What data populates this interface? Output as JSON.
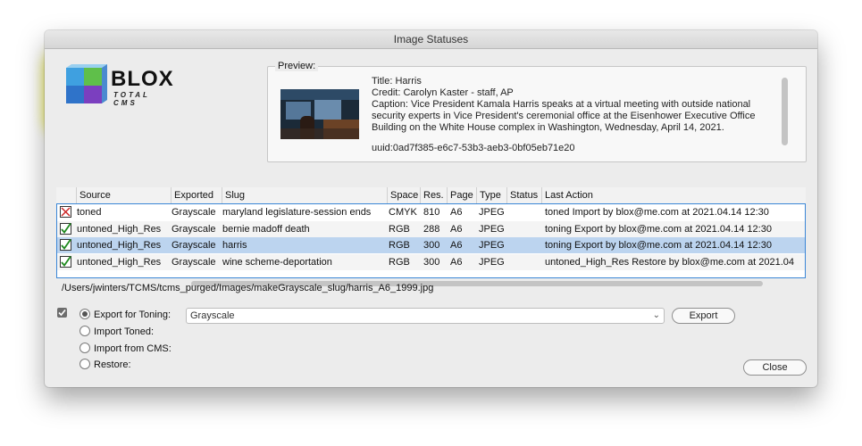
{
  "window": {
    "title": "Image Statuses"
  },
  "logo": {
    "name": "BLOX",
    "subtitle": "TOTAL CMS"
  },
  "preview": {
    "legend": "Preview:",
    "lines": [
      "Title: Harris",
      "Credit: Carolyn Kaster - staff, AP",
      "Caption: Vice President Kamala Harris speaks at a virtual meeting with outside national security experts in Vice President's ceremonial office at the Eisenhower Executive Office Building on the White House complex in Washington, Wednesday, April 14, 2021.",
      "uuid:0ad7f385-e6c7-53b3-aeb3-0bf05eb71e20"
    ]
  },
  "table": {
    "headers": [
      "Source",
      "Exported",
      "Slug",
      "Space",
      "Res.",
      "Page",
      "Type",
      "Status",
      "Last Action"
    ],
    "rows": [
      {
        "checkbox": "error",
        "source": "toned",
        "exported": "Grayscale",
        "slug": "maryland legislature-session ends",
        "space": "CMYK",
        "res": "810",
        "page": "A6",
        "type": "JPEG",
        "status": "",
        "last_action": "toned Import by blox@me.com at 2021.04.14 12:30"
      },
      {
        "checkbox": "ok",
        "source": "untoned_High_Res",
        "exported": "Grayscale",
        "slug": "bernie madoff death",
        "space": "RGB",
        "res": "288",
        "page": "A6",
        "type": "JPEG",
        "status": "",
        "last_action": "toning Export by blox@me.com at 2021.04.14 12:30"
      },
      {
        "checkbox": "ok",
        "source": "untoned_High_Res",
        "exported": "Grayscale",
        "slug": "harris",
        "space": "RGB",
        "res": "300",
        "page": "A6",
        "type": "JPEG",
        "status": "",
        "last_action": "toning Export by blox@me.com at 2021.04.14 12:30"
      },
      {
        "checkbox": "ok",
        "source": "untoned_High_Res",
        "exported": "Grayscale",
        "slug": "wine scheme-deportation",
        "space": "RGB",
        "res": "300",
        "page": "A6",
        "type": "JPEG",
        "status": "",
        "last_action": "untoned_High_Res Restore by blox@me.com at 2021.04"
      }
    ],
    "selected_row": 2
  },
  "file_path": "/Users/jwinters/TCMS/tcms_purged/Images/makeGrayscale_slug/harris_A6_1999.jpg",
  "actions": {
    "options": [
      "Export for Toning:",
      "Import Toned:",
      "Import from CMS:",
      "Restore:"
    ],
    "selected_option": "Export for Toning:",
    "export_select_value": "Grayscale",
    "export_button": "Export",
    "close_button": "Close"
  },
  "colors": {
    "highlight": "#f5f540",
    "selection": "#bcd4ef",
    "table_focus": "#3a86d6",
    "ok_mark": "#1f8a1f",
    "error_mark": "#cc2222"
  }
}
